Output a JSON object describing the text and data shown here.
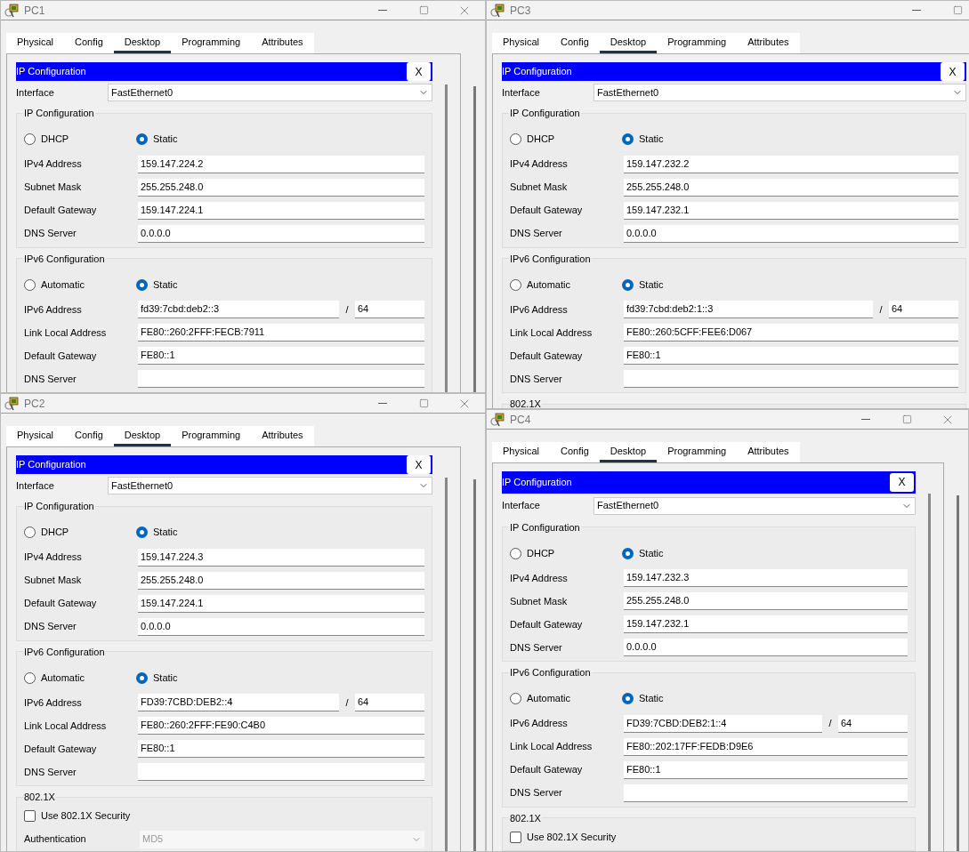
{
  "windows": [
    {
      "title": "PC1",
      "tabs": [
        {
          "label": "Physical",
          "selected": false
        },
        {
          "label": "Config",
          "selected": false
        },
        {
          "label": "Desktop",
          "selected": true
        },
        {
          "label": "Programming",
          "selected": false
        },
        {
          "label": "Attributes",
          "selected": false
        }
      ],
      "panel_title": "IP Configuration",
      "panel_close": "X",
      "interface": {
        "label": "Interface",
        "value": "FastEthernet0"
      },
      "ipv4": {
        "title": "IP Configuration",
        "options": [
          {
            "label": "DHCP",
            "selected": false
          },
          {
            "label": "Static",
            "selected": true
          }
        ],
        "fields": [
          {
            "label": "IPv4 Address",
            "value": "159.147.224.2"
          },
          {
            "label": "Subnet Mask",
            "value": "255.255.248.0"
          },
          {
            "label": "Default Gateway",
            "value": "159.147.224.1"
          },
          {
            "label": "DNS Server",
            "value": "0.0.0.0"
          }
        ]
      },
      "ipv6": {
        "title": "IPv6 Configuration",
        "options": [
          {
            "label": "Automatic",
            "selected": false
          },
          {
            "label": "Static",
            "selected": true
          }
        ],
        "fields": [
          {
            "label": "IPv6 Address",
            "value": "fd39:7cbd:deb2::3",
            "separator": "/",
            "prefix": "64"
          },
          {
            "label": "Link Local Address",
            "value": "FE80::260:2FFF:FECB:7911"
          },
          {
            "label": "Default Gateway",
            "value": "FE80::1"
          },
          {
            "label": "DNS Server"
          }
        ]
      }
    },
    {
      "title": "PC3",
      "tabs": [
        {
          "label": "Physical",
          "selected": false
        },
        {
          "label": "Config",
          "selected": false
        },
        {
          "label": "Desktop",
          "selected": true
        },
        {
          "label": "Programming",
          "selected": false
        },
        {
          "label": "Attributes",
          "selected": false
        }
      ],
      "panel_title": "IP Configuration",
      "panel_close": "X",
      "interface": {
        "label": "Interface",
        "value": "FastEthernet0"
      },
      "ipv4": {
        "title": "IP Configuration",
        "options": [
          {
            "label": "DHCP",
            "selected": false
          },
          {
            "label": "Static",
            "selected": true
          }
        ],
        "fields": [
          {
            "label": "IPv4 Address",
            "value": "159.147.232.2"
          },
          {
            "label": "Subnet Mask",
            "value": "255.255.248.0"
          },
          {
            "label": "Default Gateway",
            "value": "159.147.232.1"
          },
          {
            "label": "DNS Server",
            "value": "0.0.0.0"
          }
        ]
      },
      "ipv6": {
        "title": "IPv6 Configuration",
        "options": [
          {
            "label": "Automatic",
            "selected": false
          },
          {
            "label": "Static",
            "selected": true
          }
        ],
        "fields": [
          {
            "label": "IPv6 Address",
            "value": "fd39:7cbd:deb2:1::3",
            "separator": "/",
            "prefix": "64"
          },
          {
            "label": "Link Local Address",
            "value": "FE80::260:5CFF:FEE6:D067"
          },
          {
            "label": "Default Gateway",
            "value": "FE80::1"
          },
          {
            "label": "DNS Server"
          }
        ]
      },
      "dot1x": {
        "title": "802.1X"
      }
    },
    {
      "title": "PC2",
      "tabs": [
        {
          "label": "Physical",
          "selected": false
        },
        {
          "label": "Config",
          "selected": false
        },
        {
          "label": "Desktop",
          "selected": true
        },
        {
          "label": "Programming",
          "selected": false
        },
        {
          "label": "Attributes",
          "selected": false
        }
      ],
      "panel_title": "IP Configuration",
      "panel_close": "X",
      "interface": {
        "label": "Interface",
        "value": "FastEthernet0"
      },
      "ipv4": {
        "title": "IP Configuration",
        "options": [
          {
            "label": "DHCP",
            "selected": false
          },
          {
            "label": "Static",
            "selected": true
          }
        ],
        "fields": [
          {
            "label": "IPv4 Address",
            "value": "159.147.224.3"
          },
          {
            "label": "Subnet Mask",
            "value": "255.255.248.0"
          },
          {
            "label": "Default Gateway",
            "value": "159.147.224.1"
          },
          {
            "label": "DNS Server",
            "value": "0.0.0.0"
          }
        ]
      },
      "ipv6": {
        "title": "IPv6 Configuration",
        "options": [
          {
            "label": "Automatic",
            "selected": false
          },
          {
            "label": "Static",
            "selected": true
          }
        ],
        "fields": [
          {
            "label": "IPv6 Address",
            "value": "FD39:7CBD:DEB2::4",
            "separator": "/",
            "prefix": "64"
          },
          {
            "label": "Link Local Address",
            "value": "FE80::260:2FFF:FE90:C4B0"
          },
          {
            "label": "Default Gateway",
            "value": "FE80::1"
          },
          {
            "label": "DNS Server"
          }
        ]
      },
      "dot1x": {
        "title": "802.1X",
        "checkbox": {
          "label": "Use 802.1X Security",
          "checked": false
        },
        "auth": {
          "label": "Authentication",
          "value": "MD5",
          "disabled": true
        }
      }
    },
    {
      "title": "PC4",
      "tabs": [
        {
          "label": "Physical",
          "selected": false
        },
        {
          "label": "Config",
          "selected": false
        },
        {
          "label": "Desktop",
          "selected": true
        },
        {
          "label": "Programming",
          "selected": false
        },
        {
          "label": "Attributes",
          "selected": false
        }
      ],
      "panel_title": "IP Configuration",
      "panel_close": "X",
      "interface": {
        "label": "Interface",
        "value": "FastEthernet0"
      },
      "ipv4": {
        "title": "IP Configuration",
        "options": [
          {
            "label": "DHCP",
            "selected": false
          },
          {
            "label": "Static",
            "selected": true
          }
        ],
        "fields": [
          {
            "label": "IPv4 Address",
            "value": "159.147.232.3"
          },
          {
            "label": "Subnet Mask",
            "value": "255.255.248.0"
          },
          {
            "label": "Default Gateway",
            "value": "159.147.232.1"
          },
          {
            "label": "DNS Server",
            "value": "0.0.0.0"
          }
        ]
      },
      "ipv6": {
        "title": "IPv6 Configuration",
        "options": [
          {
            "label": "Automatic",
            "selected": false
          },
          {
            "label": "Static",
            "selected": true
          }
        ],
        "fields": [
          {
            "label": "IPv6 Address",
            "value": "FD39:7CBD:DEB2:1::4",
            "separator": "/",
            "prefix": "64"
          },
          {
            "label": "Link Local Address",
            "value": "FE80::202:17FF:FEDB:D9E6"
          },
          {
            "label": "Default Gateway",
            "value": "FE80::1"
          },
          {
            "label": "DNS Server"
          }
        ]
      },
      "dot1x": {
        "title": "802.1X",
        "checkbox": {
          "label": "Use 802.1X Security",
          "checked": false
        }
      }
    }
  ]
}
